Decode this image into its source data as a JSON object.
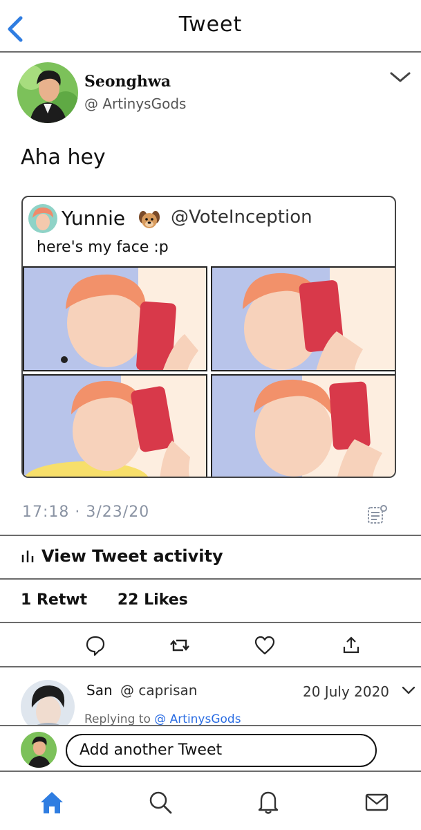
{
  "header": {
    "title": "Tweet",
    "back_icon": "chevron-left-icon",
    "accent": "#2f7de1"
  },
  "tweet": {
    "author_name": "Seonghwa",
    "author_handle": "@ ArtinysGods",
    "text": "Aha hey",
    "timestamp": "17:18 · 3/23/20",
    "quote": {
      "author_name": "Yunnie",
      "author_emoji": "dog-face-icon",
      "author_handle": "@VoteInception",
      "text": "here's my face :p"
    }
  },
  "activity_label": "View Tweet activity",
  "stats": {
    "retweets": "1 Retwt",
    "likes": "22 Likes"
  },
  "actions": [
    "reply-icon",
    "retweet-icon",
    "like-icon",
    "share-icon"
  ],
  "reply": {
    "author_name": "San",
    "author_handle": "@ caprisan",
    "date": "20 July 2020",
    "replying_prefix": "Replying to",
    "replying_handle": "@ ArtinysGods"
  },
  "composer": {
    "placeholder": "Add another Tweet"
  },
  "tabs": [
    "home-icon",
    "search-icon",
    "notifications-icon",
    "messages-icon"
  ]
}
